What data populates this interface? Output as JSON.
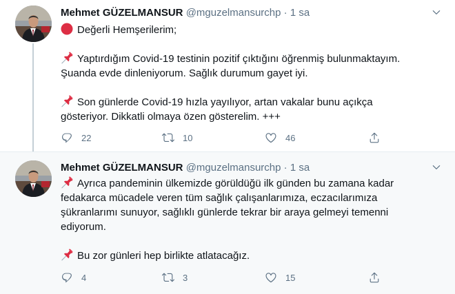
{
  "tweets": [
    {
      "author_name": "Mehmet GÜZELMANSUR",
      "handle": "@mguzelmansurchp",
      "separator": "·",
      "time": "1 sa",
      "lines": [
        {
          "emoji": "red-circle",
          "text": "Değerli Hemşerilerim;"
        },
        {
          "emoji": "",
          "text": ""
        },
        {
          "emoji": "pushpin",
          "text": "Yaptırdığım Covid-19 testinin pozitif çıktığını öğrenmiş bulunmaktayım."
        },
        {
          "emoji": "",
          "text": "Şuanda evde dinleniyorum. Sağlık durumum gayet iyi."
        },
        {
          "emoji": "",
          "text": ""
        },
        {
          "emoji": "pushpin",
          "text": "Son günlerde Covid-19 hızla yayılıyor, artan vakalar bunu açıkça"
        },
        {
          "emoji": "",
          "text": "gösteriyor. Dikkatli olmaya özen gösterelim. +++"
        }
      ],
      "replies": "22",
      "retweets": "10",
      "likes": "46"
    },
    {
      "author_name": "Mehmet GÜZELMANSUR",
      "handle": "@mguzelmansurchp",
      "separator": "·",
      "time": "1 sa",
      "lines": [
        {
          "emoji": "pushpin",
          "text": "Ayrıca pandeminin ülkemizde görüldüğü ilk günden bu zamana kadar"
        },
        {
          "emoji": "",
          "text": "fedakarca mücadele veren tüm sağlık çalışanlarımıza, eczacılarımıza"
        },
        {
          "emoji": "",
          "text": "şükranlarımı sunuyor, sağlıklı günlerde tekrar bir araya  gelmeyi temenni"
        },
        {
          "emoji": "",
          "text": "ediyorum."
        },
        {
          "emoji": "",
          "text": ""
        },
        {
          "emoji": "pushpin",
          "text": "Bu zor günleri hep birlikte atlatacağız."
        }
      ],
      "replies": "4",
      "retweets": "3",
      "likes": "15"
    }
  ],
  "colors": {
    "text": "#0f1419",
    "muted": "#5b7083",
    "thread_line": "#c4cfd6",
    "second_bg": "#f7f9fa"
  },
  "icons": [
    "reply-icon",
    "retweet-icon",
    "like-icon",
    "share-icon",
    "caret-down-icon",
    "red-circle-emoji",
    "pushpin-emoji"
  ]
}
